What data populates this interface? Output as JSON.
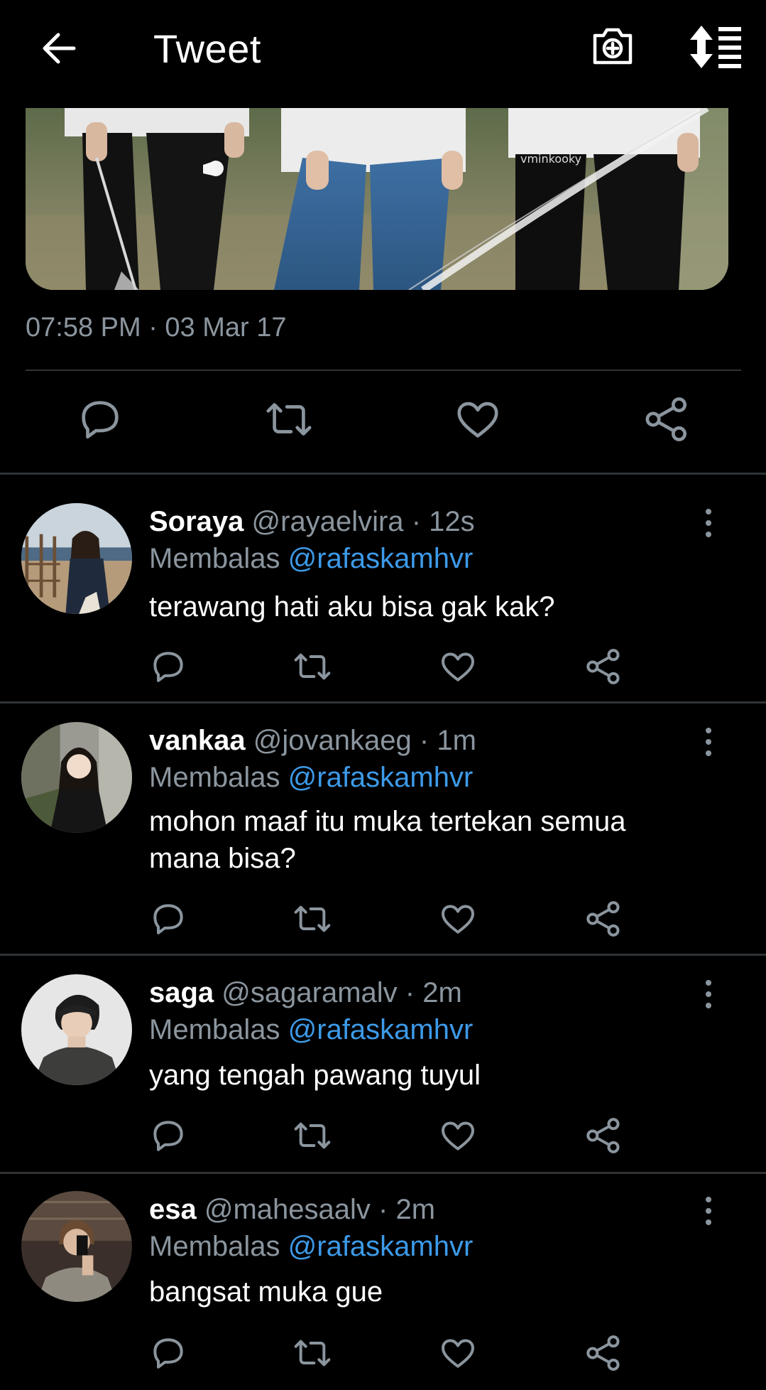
{
  "header": {
    "title": "Tweet",
    "back_icon": "arrow-left-icon",
    "camera_icon": "camera-plus-icon",
    "sort_icon": "sort-list-icon"
  },
  "tweet": {
    "media_watermark": "vminkooky",
    "timestamp": "07:58 PM · 03 Mar 17"
  },
  "colors": {
    "background": "#000000",
    "muted": "#8b959e",
    "link": "#3d9ae8",
    "divider": "#2f3336"
  },
  "replies": [
    {
      "name": "Soraya",
      "handle": "@rayaelvira",
      "time": "12s",
      "replying_label": "Membalas",
      "mention": "@rafaskamhvr",
      "text": "terawang hati aku bisa gak kak?"
    },
    {
      "name": "vankaa",
      "handle": "@jovankaeg",
      "time": "1m",
      "replying_label": "Membalas",
      "mention": "@rafaskamhvr",
      "text": "mohon maaf itu muka tertekan semua mana bisa?"
    },
    {
      "name": "saga",
      "handle": "@sagaramalv",
      "time": "2m",
      "replying_label": "Membalas",
      "mention": "@rafaskamhvr",
      "text": "yang tengah pawang tuyul"
    },
    {
      "name": "esa",
      "handle": "@mahesaalv",
      "time": "2m",
      "replying_label": "Membalas",
      "mention": "@rafaskamhvr",
      "text": "bangsat muka gue"
    }
  ],
  "separator": "·"
}
